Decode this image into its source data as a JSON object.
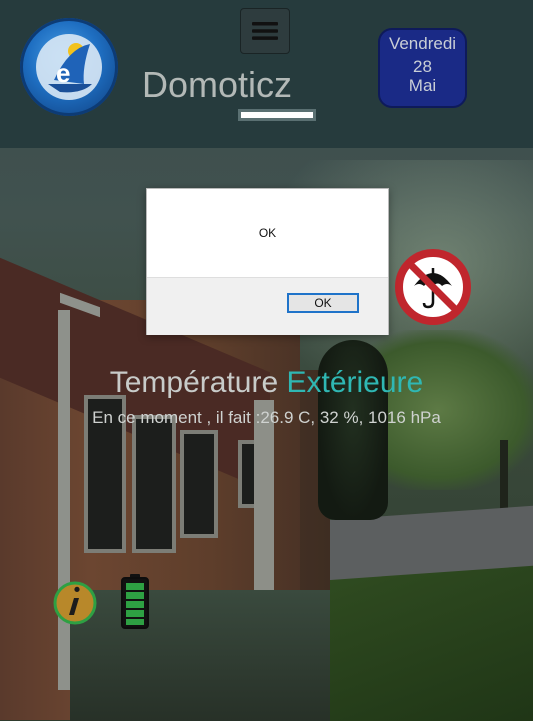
{
  "app": {
    "title": "Domoticz"
  },
  "date": {
    "weekday": "Vendredi",
    "day": "28",
    "month": "Mai"
  },
  "weather": {
    "title_part1": "Température ",
    "title_part2": "Extérieure",
    "current": "En ce moment , il fait :26.9 C, 32 %, 1016 hPa"
  },
  "dialog": {
    "message": "OK",
    "ok_label": "OK"
  },
  "icons": {
    "menu": "hamburger-menu-icon",
    "logo": "domoticz-logo-icon",
    "umbrella": "no-umbrella-icon",
    "info": "info-icon",
    "battery": "battery-full-icon"
  },
  "colors": {
    "accent": "#2fb7b3",
    "date_bg": "#1a2a86",
    "header_bg": "#253a3c",
    "battery_green": "#2ea043",
    "no_sign_red": "#c0262d"
  }
}
